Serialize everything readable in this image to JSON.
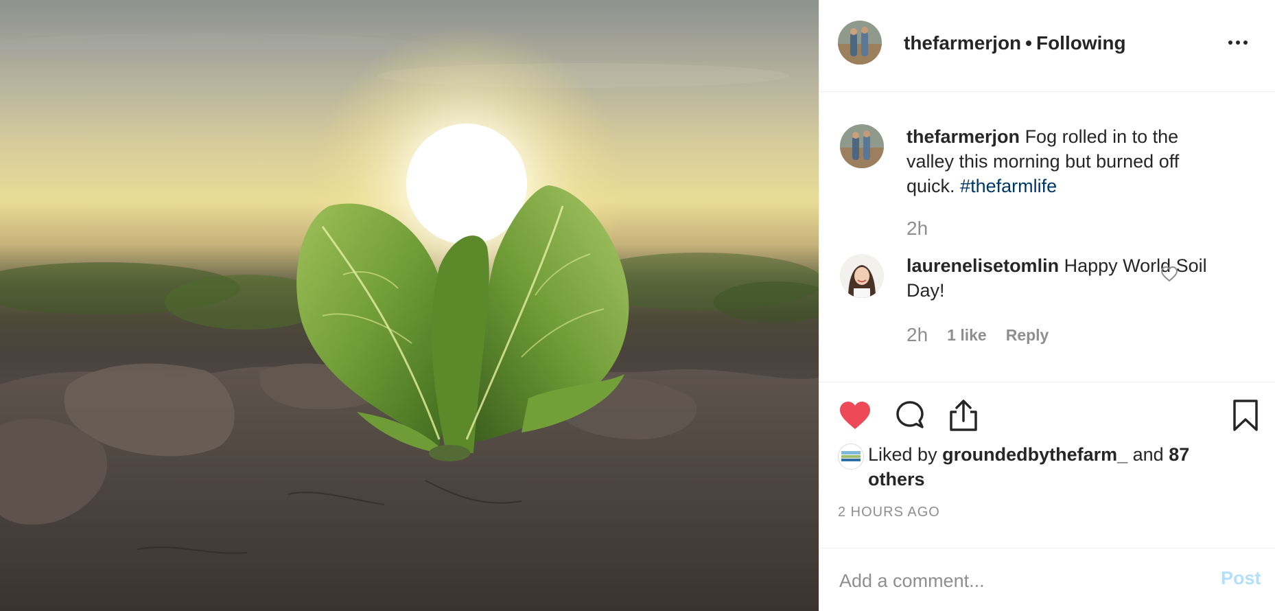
{
  "post": {
    "image_alt": "",
    "header": {
      "username": "thefarmerjon",
      "separator": "•",
      "follow_status": "Following"
    },
    "caption": {
      "username": "thefarmerjon",
      "text": "Fog rolled in to the valley this morning but burned off quick.",
      "hashtag": "#thefarmlife",
      "time": "2h"
    },
    "comments": [
      {
        "username": "laurenelisetomlin",
        "text": "Happy World Soil Day!",
        "time": "2h",
        "likes": "1 like",
        "reply_label": "Reply"
      }
    ],
    "likes": {
      "prefix": "Liked by",
      "user": "groundedbythefarm_",
      "connector": "and",
      "others": "87 others"
    },
    "timestamp": "2 HOURS AGO",
    "comment_input": {
      "placeholder": "Add a comment...",
      "post_label": "Post"
    },
    "colors": {
      "like_red": "#ed4956",
      "hashtag_blue": "#00376b",
      "post_disabled_blue": "#b2dffc",
      "muted_gray": "#8e8e8e"
    },
    "icons": [
      "more-icon",
      "heart-icon",
      "comment-icon",
      "share-icon",
      "bookmark-icon",
      "heart-outline-icon"
    ],
    "state": {
      "liked": true,
      "saved": false
    }
  }
}
